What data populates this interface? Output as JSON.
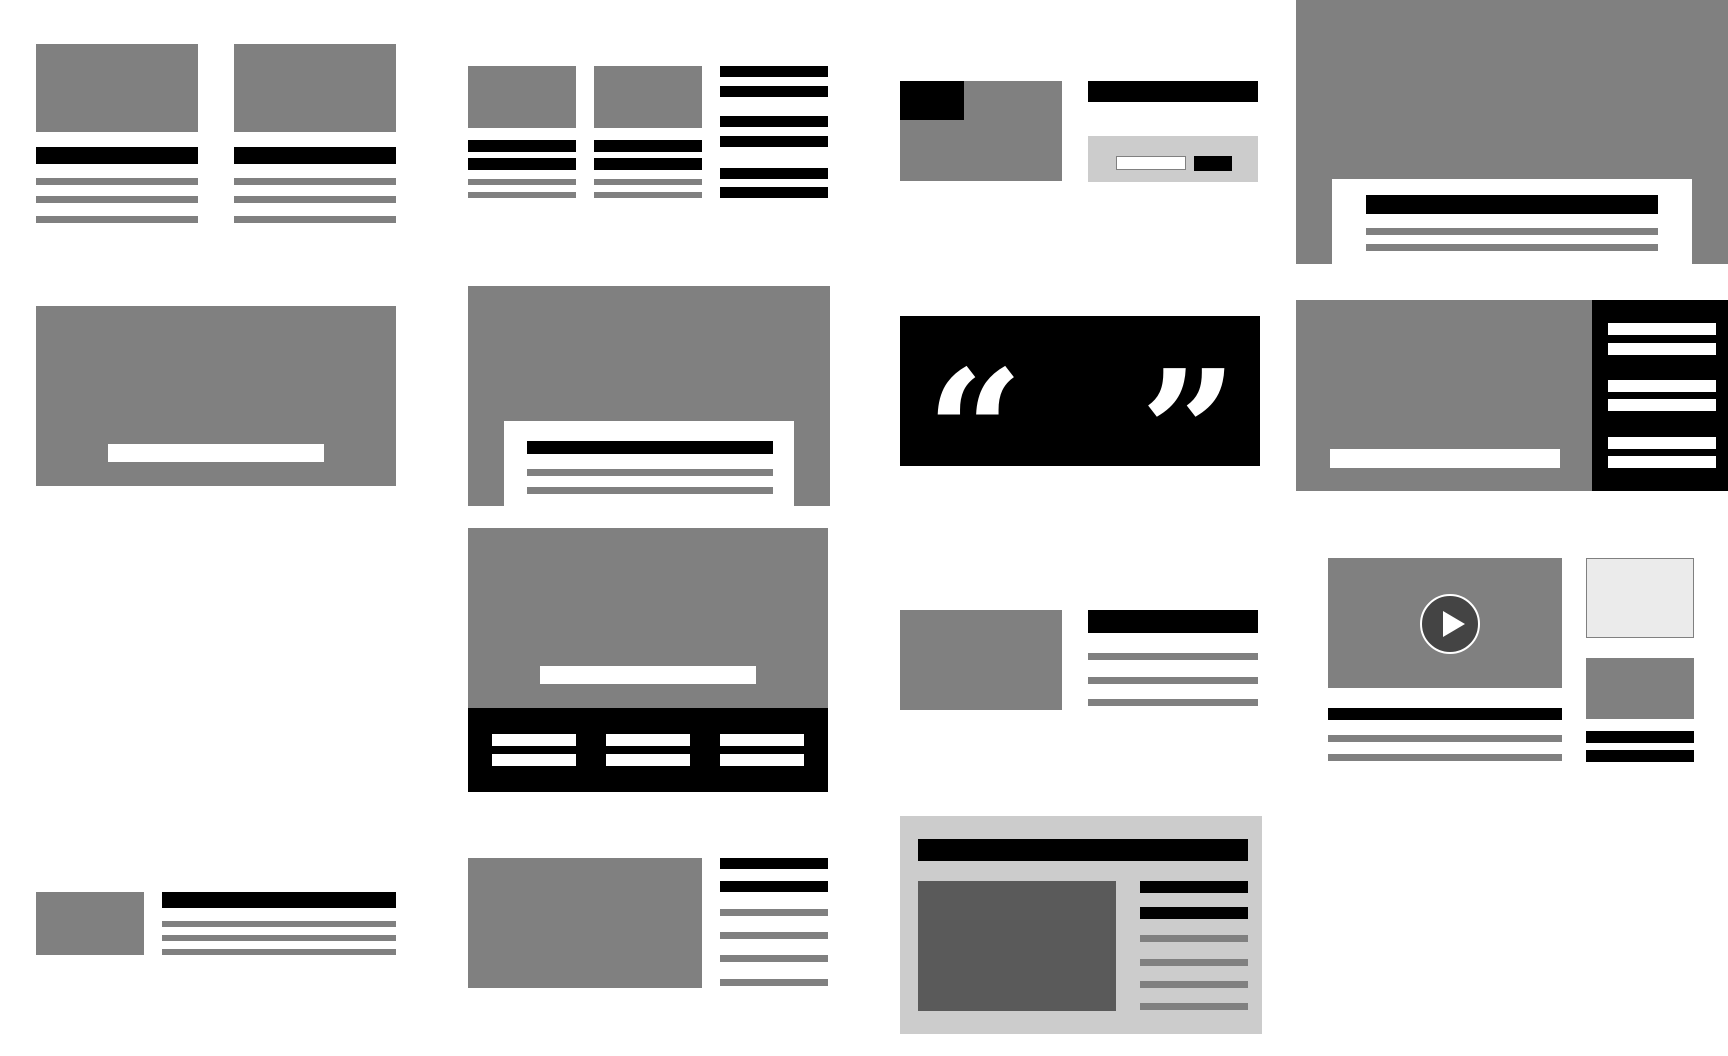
{
  "canvas": {
    "width": 1728,
    "height": 1056
  },
  "palette": {
    "background": "#ffffff",
    "placeholder_gray": "#808080",
    "heading_black": "#000000",
    "panel_light_gray": "#cccccc",
    "media_dark_gray": "#5a5a5a"
  },
  "templates": [
    {
      "id": "two-card-grid"
    },
    {
      "id": "three-column-news"
    },
    {
      "id": "image-with-signup"
    },
    {
      "id": "hero-overlap-card"
    },
    {
      "id": "banner-with-caption"
    },
    {
      "id": "image-overlap-card"
    },
    {
      "id": "quote-block",
      "quote_open": "“",
      "quote_close": "”"
    },
    {
      "id": "hero-with-dark-sidebar"
    },
    {
      "id": "hero-with-footer-links"
    },
    {
      "id": "image-left-text-right"
    },
    {
      "id": "video-with-sidebar",
      "icon": "play-icon"
    },
    {
      "id": "small-thumb-text"
    },
    {
      "id": "large-image-link-list"
    },
    {
      "id": "framed-feature-panel"
    }
  ]
}
